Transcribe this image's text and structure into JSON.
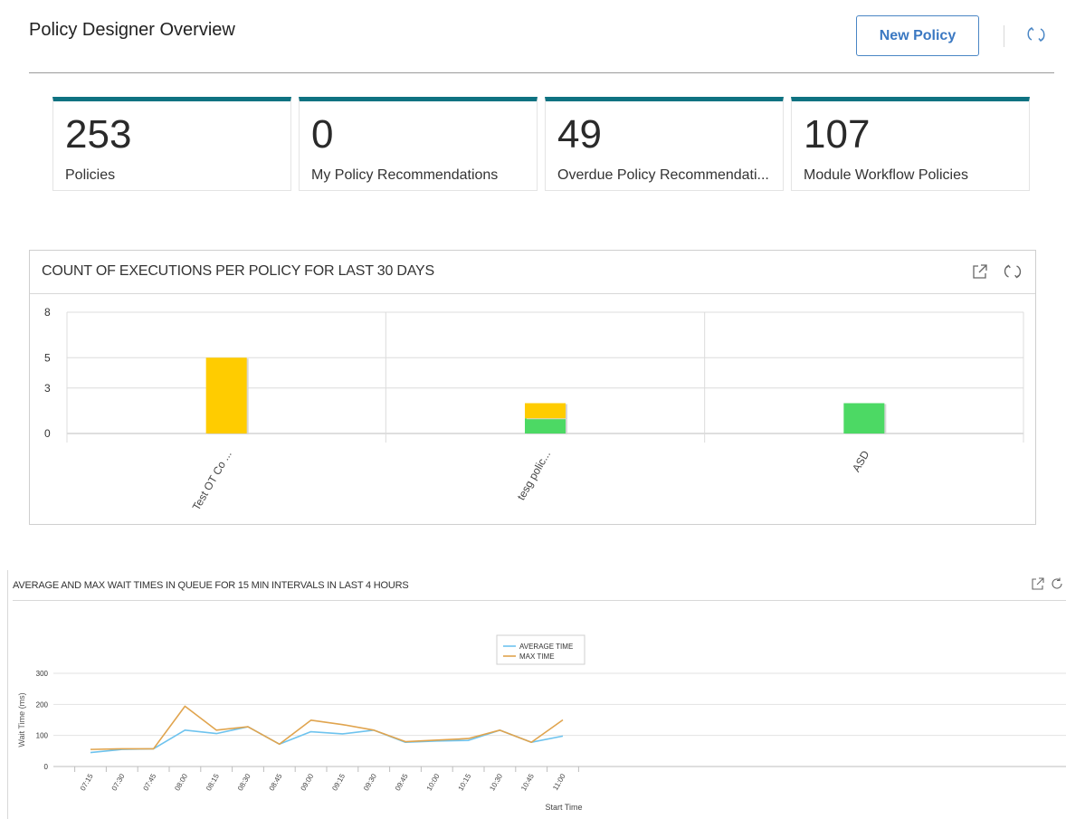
{
  "header": {
    "title": "Policy Designer Overview",
    "new_policy_label": "New Policy"
  },
  "tiles": [
    {
      "count": "253",
      "label": "Policies"
    },
    {
      "count": "0",
      "label": "My Policy Recommendations"
    },
    {
      "count": "49",
      "label": "Overdue Policy Recommendati..."
    },
    {
      "count": "107",
      "label": "Module Workflow Policies"
    }
  ],
  "colors": {
    "tile_accent": "#0e7281",
    "button_text": "#3a78c2",
    "bar_yellow": "#ffcc00",
    "bar_green": "#4cd964",
    "line_average": "#6ec3ee",
    "line_max": "#e0a44e"
  },
  "executions_widget": {
    "title": "COUNT OF EXECUTIONS PER POLICY FOR LAST 30 DAYS",
    "icons": [
      "external-link-icon",
      "refresh-icon"
    ]
  },
  "wait_widget": {
    "title": "AVERAGE AND MAX WAIT TIMES IN QUEUE FOR 15 MIN INTERVALS IN LAST 4 HOURS",
    "icons": [
      "external-link-icon",
      "refresh-icon"
    ]
  },
  "chart_data": [
    {
      "type": "bar",
      "stacked": true,
      "title": "COUNT OF EXECUTIONS PER POLICY FOR LAST 30 DAYS",
      "categories": [
        "Test OT Co ...",
        "tesg polic...",
        "ASD"
      ],
      "yticks": [
        "0",
        "3",
        "5",
        "8"
      ],
      "ylim": [
        0,
        8
      ],
      "series": [
        {
          "color": "#4cd964",
          "values": [
            0,
            1,
            2
          ]
        },
        {
          "color": "#ffcc00",
          "values": [
            5,
            1,
            0
          ]
        }
      ],
      "grid": true
    },
    {
      "type": "line",
      "title": "AVERAGE AND MAX WAIT TIMES IN QUEUE FOR 15 MIN INTERVALS IN LAST 4 HOURS",
      "xlabel": "Start Time",
      "ylabel": "Wait Time (ms)",
      "x": [
        "07:15",
        "07:30",
        "07:45",
        "08:00",
        "08:15",
        "08:30",
        "08:45",
        "09:00",
        "09:15",
        "09:30",
        "09:45",
        "10:00",
        "10:15",
        "10:30",
        "10:45",
        "11:00"
      ],
      "yticks": [
        "0",
        "100",
        "200",
        "300"
      ],
      "ylim": [
        0,
        300
      ],
      "legend_position": "top-center",
      "grid": true,
      "series": [
        {
          "name": "AVERAGE TIME",
          "color": "#6ec3ee",
          "values": [
            45,
            55,
            57,
            117,
            106,
            128,
            72,
            112,
            105,
            117,
            78,
            82,
            84,
            117,
            78,
            98
          ]
        },
        {
          "name": "MAX TIME",
          "color": "#e0a44e",
          "values": [
            55,
            57,
            57,
            194,
            117,
            128,
            72,
            149,
            135,
            117,
            80,
            85,
            90,
            117,
            78,
            150
          ]
        }
      ]
    }
  ]
}
